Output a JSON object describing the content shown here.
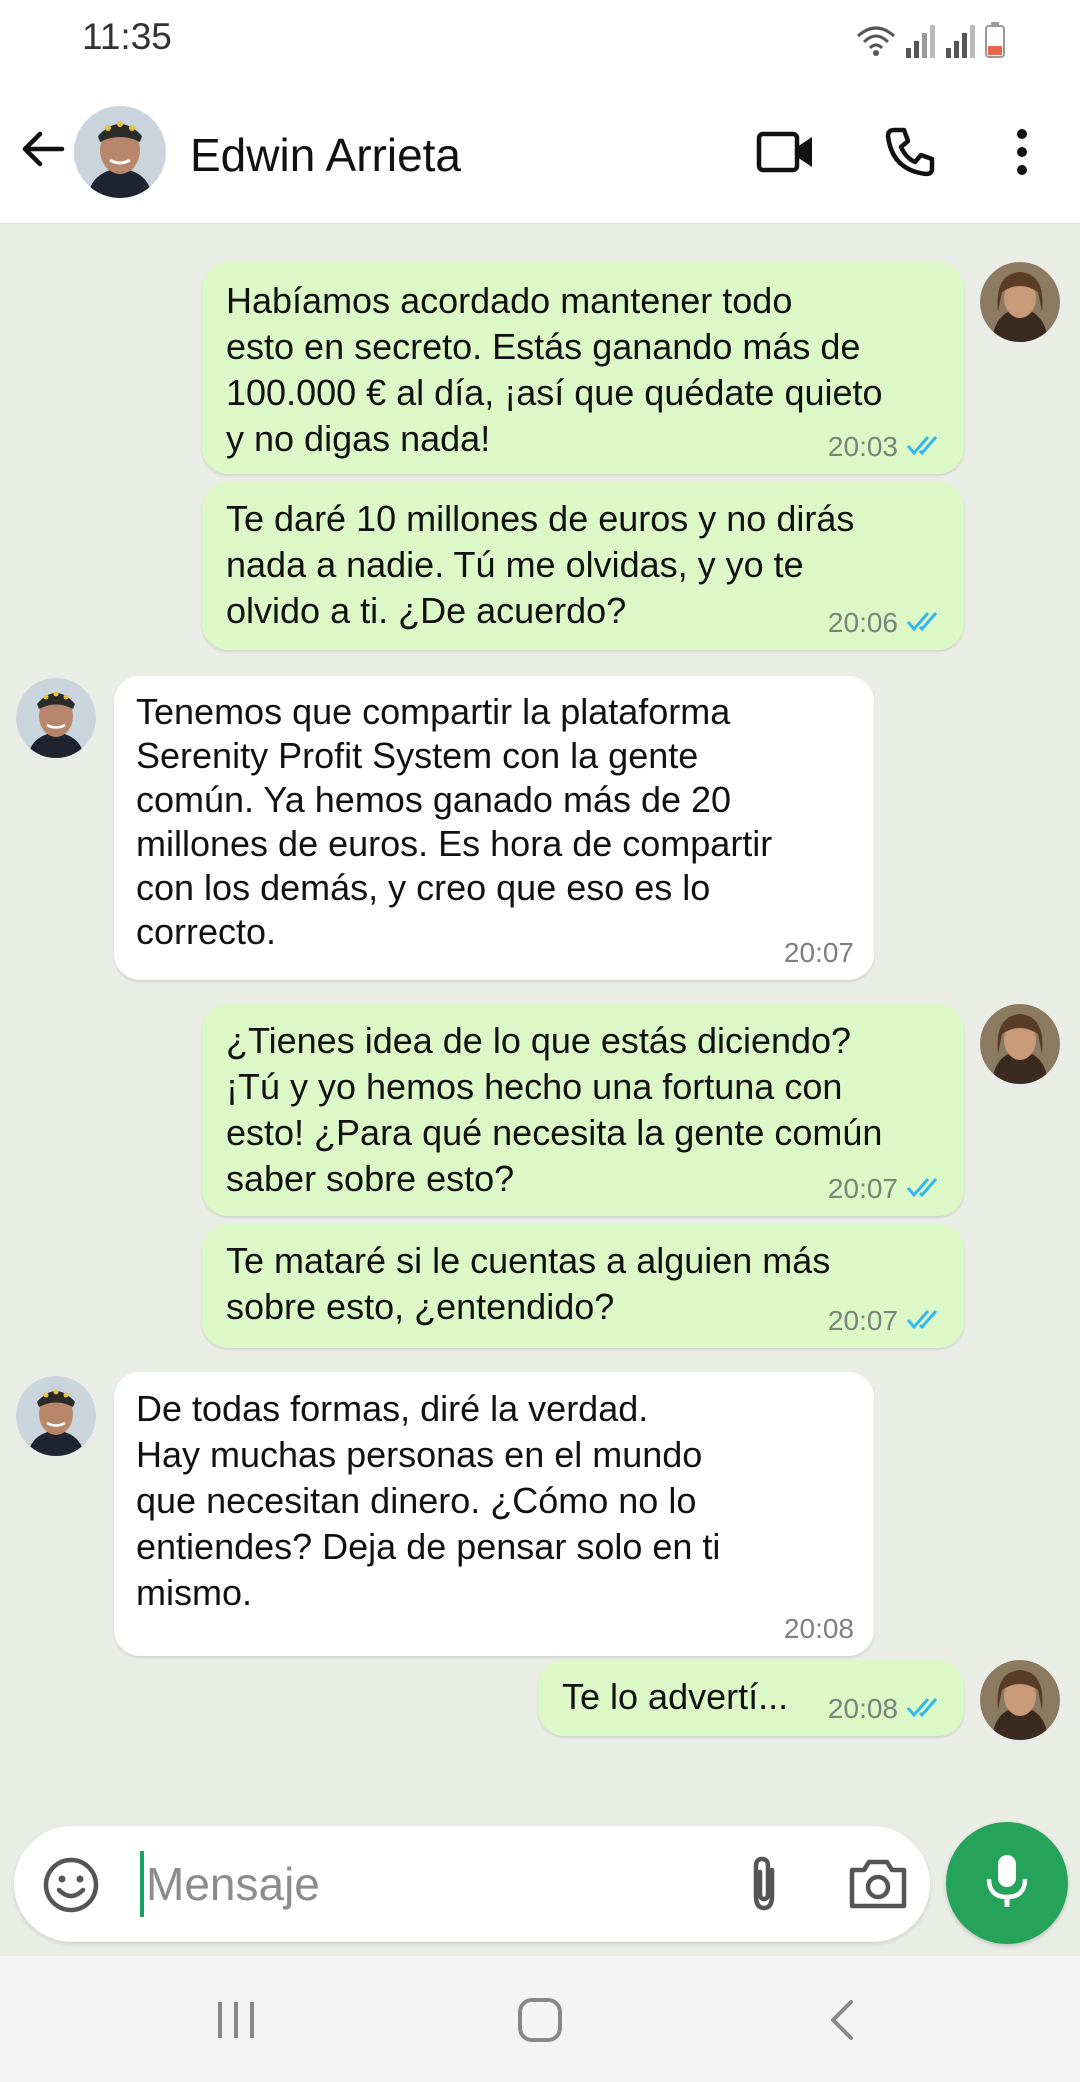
{
  "status_bar": {
    "time": "11:35",
    "icons": [
      "wifi-icon",
      "signal-icon",
      "signal-icon",
      "battery-icon"
    ]
  },
  "header": {
    "contact_name": "Edwin Arrieta",
    "actions": [
      "video-call-icon",
      "phone-icon",
      "more-options-icon"
    ]
  },
  "messages": [
    {
      "dir": "out",
      "text": "Habíamos acordado mantener todo\nesto en secreto. Estás ganando más de\n100.000 € al día, ¡así que quédate quieto\ny no digas nada!",
      "time": "20:03",
      "read": true
    },
    {
      "dir": "out",
      "text": "Te daré 10 millones de euros y no dirás\nnada a nadie. Tú me olvidas, y yo te\nolvido a ti. ¿De acuerdo?",
      "time": "20:06",
      "read": true
    },
    {
      "dir": "in",
      "text": "Tenemos que compartir la plataforma\nSerenity Profit System con la gente\ncomún. Ya hemos ganado más de 20\nmillones de euros. Es hora de compartir\ncon los demás, y creo que eso es lo\ncorrecto.",
      "time": "20:07"
    },
    {
      "dir": "out",
      "text": "¿Tienes idea de lo que estás diciendo?\n¡Tú y yo hemos hecho una fortuna con\nesto! ¿Para qué necesita la gente común\nsaber sobre esto?",
      "time": "20:07",
      "read": true
    },
    {
      "dir": "out",
      "text": "Te mataré si le cuentas a alguien más\nsobre esto, ¿entendido?",
      "time": "20:07",
      "read": true
    },
    {
      "dir": "in",
      "text": "De todas formas, diré la verdad.\nHay muchas personas en el mundo\nque necesitan dinero. ¿Cómo no lo\nentiendes? Deja de pensar solo en ti\nmismo.",
      "time": "20:08"
    },
    {
      "dir": "out",
      "text": "Te lo advertí...",
      "time": "20:08",
      "read": true
    }
  ],
  "composer": {
    "placeholder": "Mensaje",
    "value": ""
  },
  "colors": {
    "outgoing_bubble": "#dcf8c6",
    "incoming_bubble": "#ffffff",
    "chat_background": "#e9ede6",
    "read_ticks": "#34b7f1",
    "mic_button": "#25a35a"
  }
}
